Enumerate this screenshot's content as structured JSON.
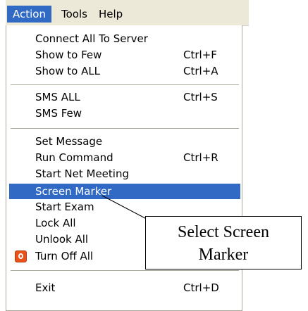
{
  "menubar": {
    "items": [
      {
        "label": "Action",
        "active": true
      },
      {
        "label": "Tools",
        "active": false
      },
      {
        "label": "Help",
        "active": false
      }
    ]
  },
  "menu": {
    "items": [
      {
        "label": "Connect All To Server",
        "shortcut": ""
      },
      {
        "label": "Show to Few",
        "shortcut": "Ctrl+F"
      },
      {
        "label": "Show to ALL",
        "shortcut": "Ctrl+A"
      },
      {
        "label": "SMS ALL",
        "shortcut": "Ctrl+S"
      },
      {
        "label": "SMS Few",
        "shortcut": ""
      },
      {
        "label": "Set Message",
        "shortcut": ""
      },
      {
        "label": "Run Command",
        "shortcut": "Ctrl+R"
      },
      {
        "label": "Start Net Meeting",
        "shortcut": ""
      },
      {
        "label": "Screen Marker",
        "shortcut": "",
        "highlighted": true
      },
      {
        "label": "Start Exam",
        "shortcut": ""
      },
      {
        "label": "Lock All",
        "shortcut": ""
      },
      {
        "label": "Unlook  All",
        "shortcut": ""
      },
      {
        "label": "Turn Off All",
        "shortcut": "",
        "icon": "power-off-icon"
      },
      {
        "label": "Exit",
        "shortcut": "Ctrl+D"
      }
    ]
  },
  "callout": {
    "line1": "Select Screen",
    "line2": "Marker"
  },
  "colors": {
    "highlight": "#316ac5",
    "menubar_bg": "#ece9d8",
    "icon": "#e8531a"
  }
}
